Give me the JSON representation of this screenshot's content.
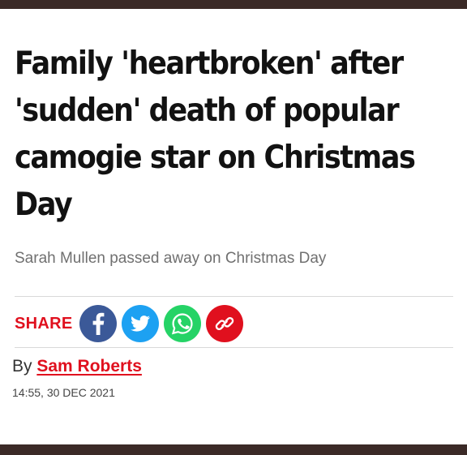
{
  "article": {
    "headline_lines": [
      "Family 'heartbroken' after",
      "'sudden' death of popular",
      "camogie star on Christmas",
      "Day"
    ],
    "subheadline": "Sarah Mullen passed away on Christmas Day",
    "share": {
      "label": "SHARE",
      "buttons": [
        {
          "icon": "facebook-icon",
          "color": "#3b5998"
        },
        {
          "icon": "twitter-icon",
          "color": "#1da1f2"
        },
        {
          "icon": "whatsapp-icon",
          "color": "#25d366"
        },
        {
          "icon": "link-icon",
          "color": "#e0101e"
        }
      ]
    },
    "byline_prefix": "By",
    "author": "Sam Roberts",
    "timestamp": "14:55, 30 DEC 2021"
  },
  "colors": {
    "accent": "#e0101e",
    "frame": "#3b2a27"
  }
}
